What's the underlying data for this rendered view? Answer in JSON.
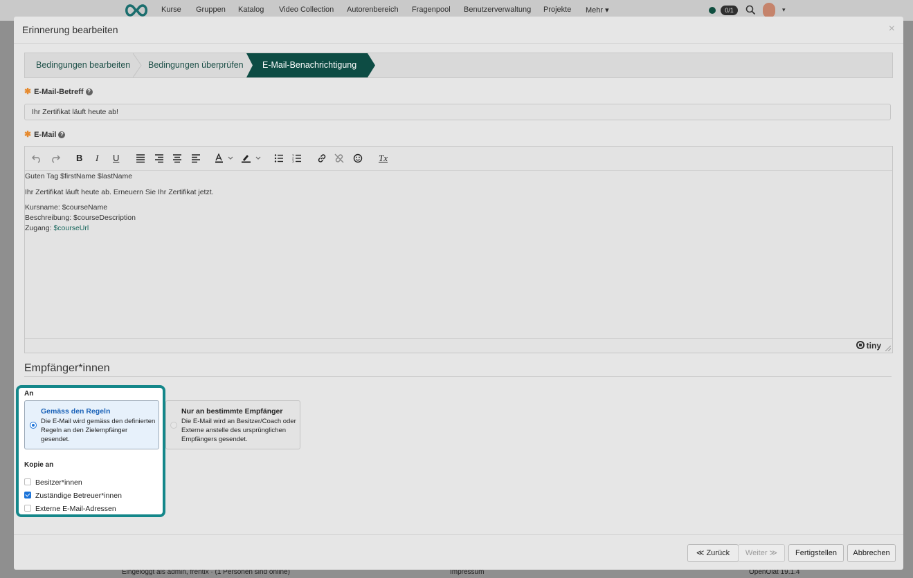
{
  "topnav": {
    "items": [
      "Kurse",
      "Gruppen",
      "Katalog",
      "Video Collection",
      "Autorenbereich",
      "Fragenpool",
      "Benutzerverwaltung",
      "Projekte",
      "Mehr ▾"
    ],
    "counter": "0/1",
    "more_caret": "▾"
  },
  "footer": {
    "left": "Eingeloggt als admin, frentix · (1 Personen sind online)",
    "center": "Impressum",
    "right": "OpenOlat 19.1.4"
  },
  "modal": {
    "title": "Erinnerung bearbeiten",
    "close_symbol": "×"
  },
  "wizard": {
    "steps": [
      "Bedingungen bearbeiten",
      "Bedingungen überprüfen",
      "E-Mail-Benachrichtigung"
    ],
    "active_color": "#0d4c44"
  },
  "form": {
    "subject_label": "E-Mail-Betreff",
    "subject_value": "Ihr Zertifikat läuft heute ab!",
    "email_label": "E-Mail",
    "help_symbol": "?",
    "required_symbol": "✱"
  },
  "editor": {
    "toolbar_icons": [
      "undo-icon",
      "redo-icon",
      "bold-icon",
      "italic-icon",
      "underline-icon",
      "align-justify-icon",
      "align-right-icon",
      "align-center-icon",
      "align-left-icon",
      "text-color-icon",
      "highlight-icon",
      "bullet-list-icon",
      "numbered-list-icon",
      "link-icon",
      "unlink-icon",
      "emoji-icon",
      "clear-format-icon"
    ],
    "bold_label": "B",
    "italic_label": "I",
    "underline_label": "U",
    "clear_label": "Tx",
    "lines": {
      "greeting": "Guten Tag $firstName $lastName",
      "intro": "Ihr Zertifikat läuft heute ab. Erneuern Sie Ihr Zertifikat jetzt.",
      "course_name": "Kursname: $courseName",
      "description": "Beschreibung: $courseDescription",
      "access_prefix": "Zugang: ",
      "access_link": "$courseUrl"
    },
    "brand": "tiny"
  },
  "recipients": {
    "section_title": "Empfänger*innen",
    "to_label": "An",
    "option_rules_title": "Gemäss den Regeln",
    "option_rules_desc": "Die E-Mail wird gemäss den definierten Regeln an den Zielempfänger gesendet.",
    "option_specific_title": "Nur an bestimmte Empfänger",
    "option_specific_desc": "Die E-Mail wird an Besitzer/Coach oder Externe anstelle des ursprünglichen Empfängers gesendet.",
    "copy_label": "Kopie an",
    "copy_owners": "Besitzer*innen",
    "copy_coaches": "Zuständige Betreuer*innen",
    "copy_external": "Externe E-Mail-Adressen",
    "highlight_color": "#14878a"
  },
  "buttons": {
    "back": "≪ Zurück",
    "next": "Weiter ≫",
    "finish": "Fertigstellen",
    "cancel": "Abbrechen"
  }
}
